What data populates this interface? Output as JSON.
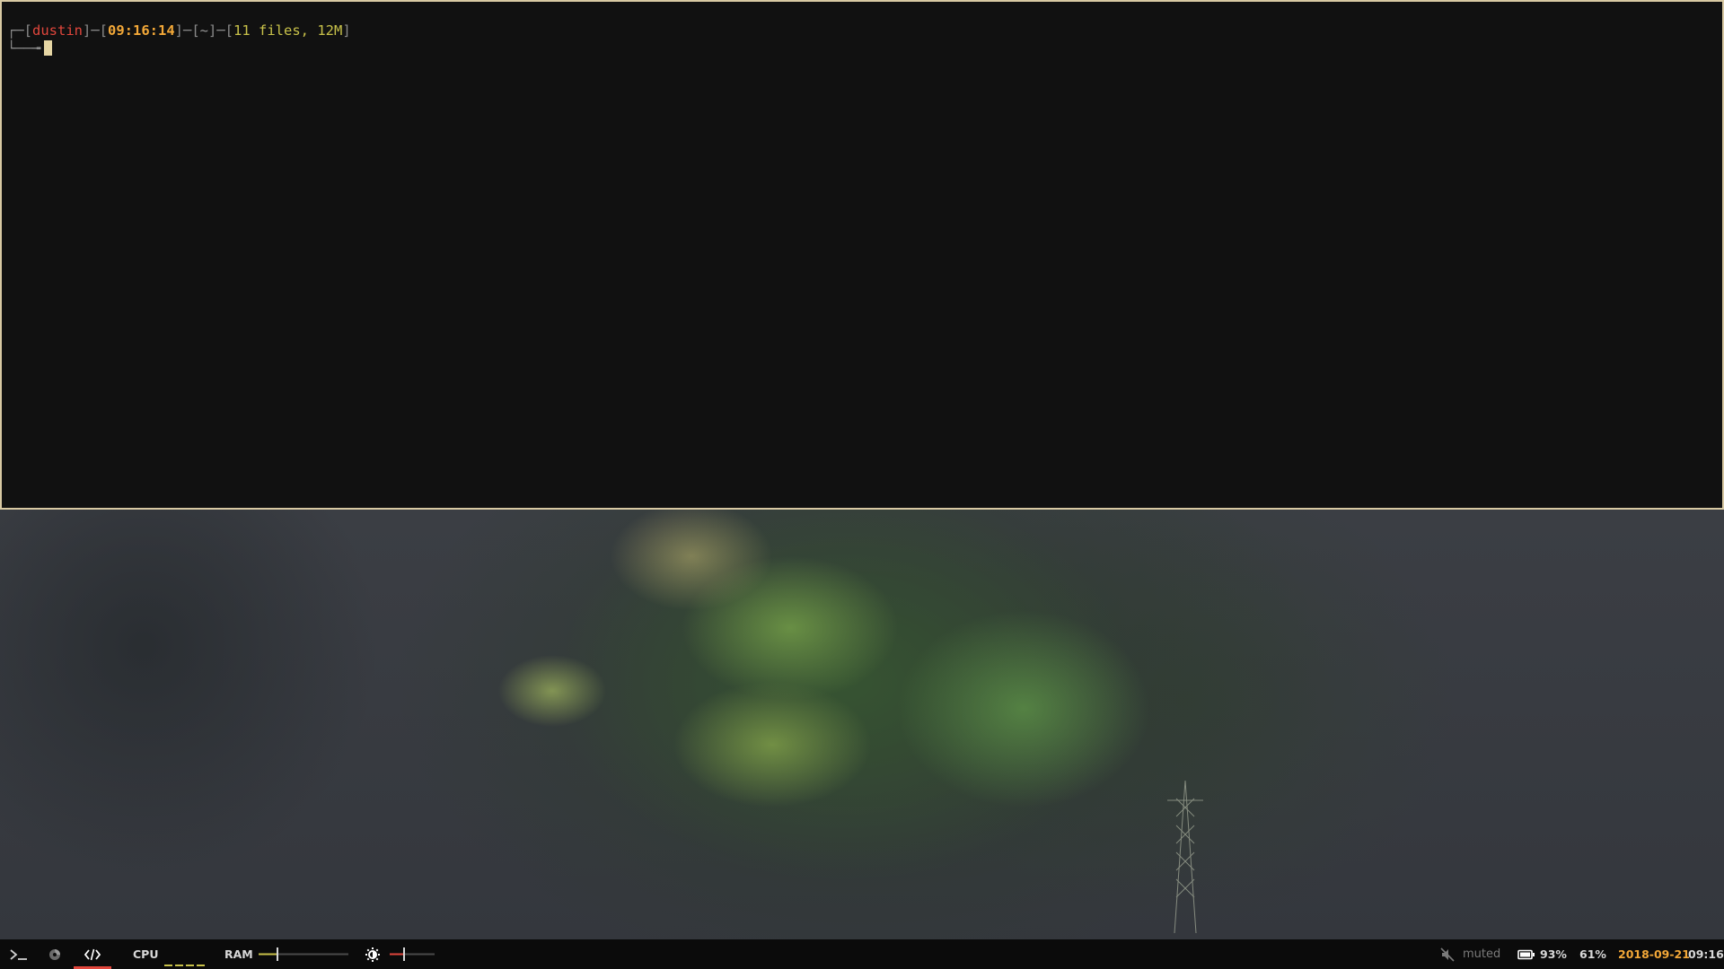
{
  "terminal": {
    "prompt": {
      "corner_top": "┌─",
      "corner_bottom": "└──╼",
      "user": "dustin",
      "time": "09:16:14",
      "dir": "~",
      "files": "11 files, 12M"
    }
  },
  "taskbar": {
    "tags": [
      {
        "icon": "terminal-icon"
      },
      {
        "icon": "firefox-icon"
      },
      {
        "icon": "code-icon",
        "active": true
      }
    ],
    "cpu_label": "CPU",
    "ram_label": "RAM",
    "ram_level": 0.2,
    "brightness_level": 0.3,
    "volume_status": "muted",
    "battery_percent": "93%",
    "brightness_percent": "61%",
    "date": "2018-09-21",
    "time": "09:16",
    "colors": {
      "accent_red": "#e0463c",
      "accent_orange": "#f3a838",
      "accent_olive": "#c9c24a",
      "border": "#d8c9a3"
    }
  }
}
